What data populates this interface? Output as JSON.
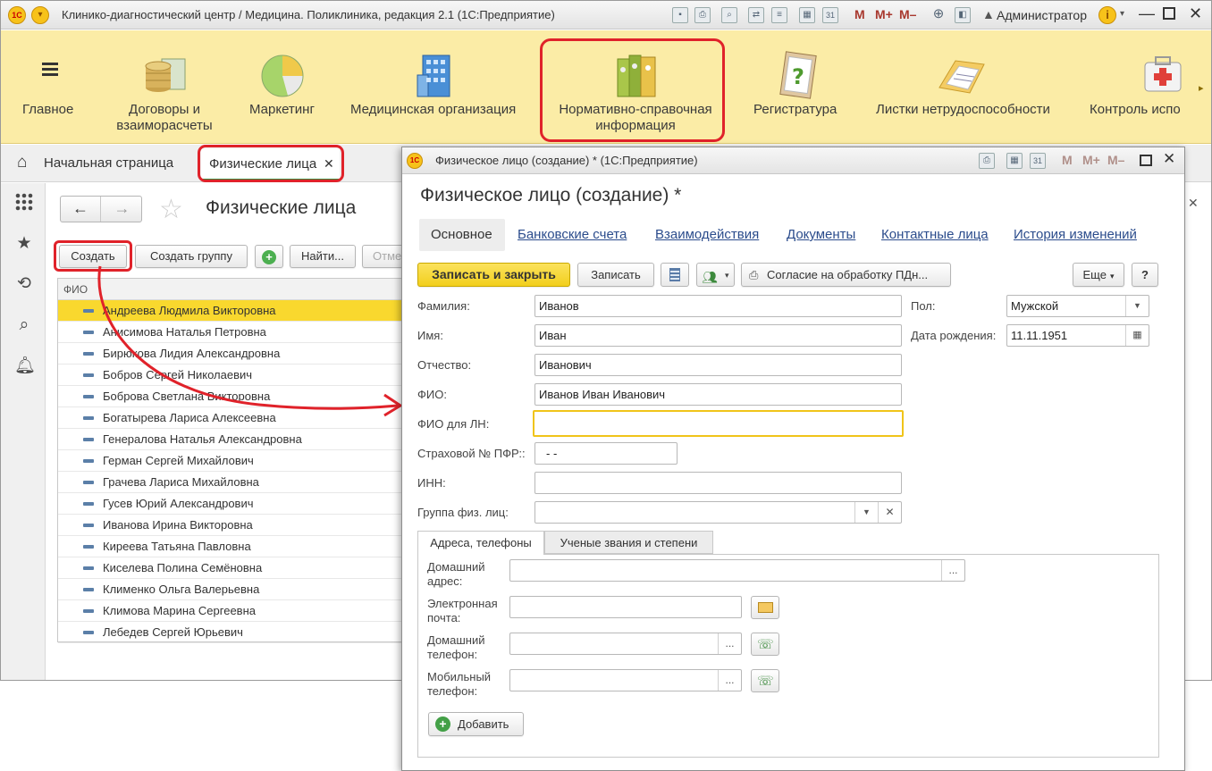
{
  "window": {
    "title": "Клинико-диагностический центр / Медицина. Поликлиника, редакция 2.1  (1С:Предприятие)",
    "logo": "1С",
    "user": "Администратор",
    "mm_buttons": [
      "M",
      "M+",
      "M–"
    ]
  },
  "sections": [
    {
      "label": "Главное",
      "icon": "menu-icon"
    },
    {
      "label": "Договоры и взаиморасчеты",
      "icon": "coins-icon"
    },
    {
      "label": "Маркетинг",
      "icon": "pie-chart-icon"
    },
    {
      "label": "Медицинская организация",
      "icon": "building-icon"
    },
    {
      "label": "Нормативно-справочная информация",
      "icon": "binders-icon"
    },
    {
      "label": "Регистратура",
      "icon": "clipboard-question-icon"
    },
    {
      "label": "Листки нетрудоспособности",
      "icon": "folder-docs-icon"
    },
    {
      "label": "Контроль испо",
      "icon": "first-aid-icon"
    }
  ],
  "tabs": {
    "home": "Начальная страница",
    "active": "Физические лица",
    "close": "✕"
  },
  "list": {
    "title": "Физические лица",
    "create": "Создать",
    "create_group": "Создать группу",
    "find": "Найти...",
    "cancel_partial": "Отме",
    "column": "ФИО",
    "rows": [
      "Андреева Людмила Викторовна",
      "Анисимова Наталья Петровна",
      "Бирюкова Лидия Александровна",
      "Бобров Сергей Николаевич",
      "Боброва Светлана Викторовна",
      "Богатырева Лариса Алексеевна",
      "Генералова Наталья Александровна",
      "Герман Сергей Михайлович",
      "Грачева Лариса Михайловна",
      "Гусев Юрий Александрович",
      "Иванова Ирина Викторовна",
      "Киреева Татьяна Павловна",
      "Киселева Полина Семёновна",
      "Клименко Ольга Валерьевна",
      "Климова Марина Сергеевна",
      "Лебедев Сергей Юрьевич"
    ]
  },
  "form": {
    "window_title": "Физическое лицо (создание) * (1С:Предприятие)",
    "heading": "Физическое лицо (создание) *",
    "tabs": [
      "Основное",
      "Банковские счета",
      "Взаимодействия",
      "Документы",
      "Контактные лица",
      "История изменений"
    ],
    "save_close": "Записать и закрыть",
    "save": "Записать",
    "consent": "Согласие на обработку ПДн...",
    "more": "Еще",
    "help": "?",
    "fields": {
      "surname_label": "Фамилия:",
      "surname": "Иванов",
      "name_label": "Имя:",
      "name": "Иван",
      "patronymic_label": "Отчество:",
      "patronymic": "Иванович",
      "fio_label": "ФИО:",
      "fio": "Иванов Иван Иванович",
      "fio_ln_label": "ФИО для ЛН:",
      "fio_ln": "",
      "snils_label": "Страховой № ПФР::",
      "snils": "-  -",
      "inn_label": "ИНН:",
      "inn": "",
      "group_label": "Группа физ. лиц:",
      "group": "",
      "gender_label": "Пол:",
      "gender": "Мужской",
      "birth_label": "Дата рождения:",
      "birth": "11.11.1951"
    },
    "subtabs": [
      "Адреса, телефоны",
      "Ученые звания и степени"
    ],
    "contacts": {
      "home_address_1": "Домашний",
      "home_address_2": "адрес:",
      "email_1": "Электронная",
      "email_2": "почта:",
      "home_phone_1": "Домашний",
      "home_phone_2": "телефон:",
      "mobile_1": "Мобильный",
      "mobile_2": "телефон:",
      "add": "Добавить",
      "ellipsis": "..."
    }
  },
  "colors": {
    "accent_yellow": "#f5d535",
    "sections_bg": "#fbeca6",
    "annotation_red": "#e0222a",
    "link_blue": "#2b4c8c"
  }
}
